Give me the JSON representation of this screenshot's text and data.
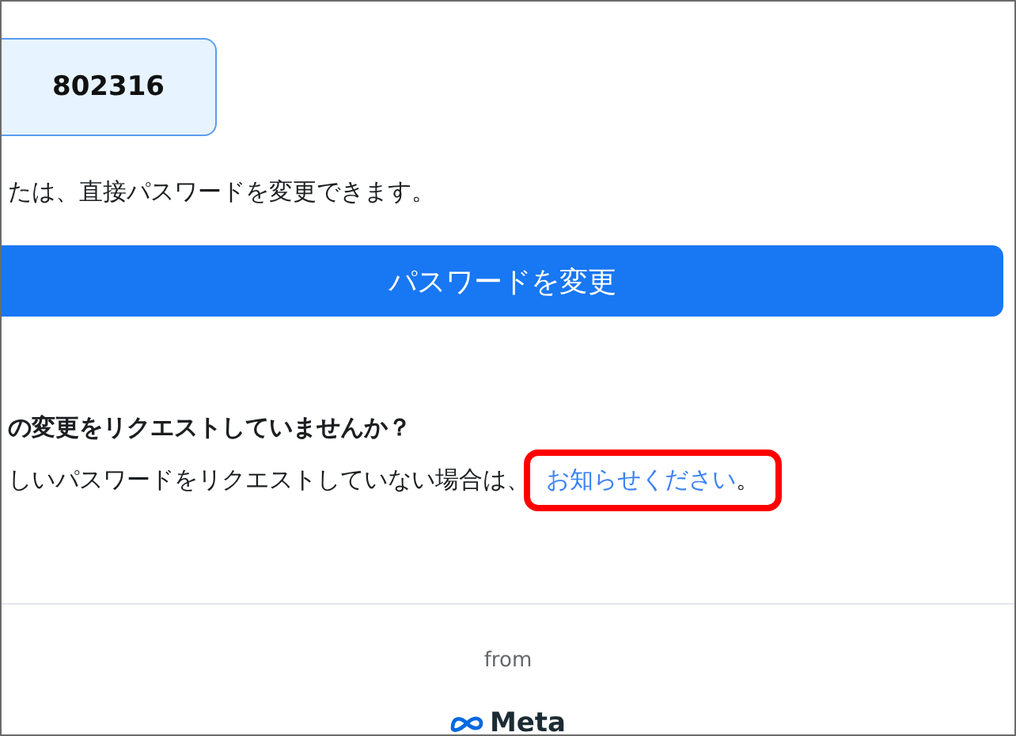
{
  "code": {
    "value": "802316"
  },
  "instruction": "たは、直接パスワードを変更できます。",
  "change_button": {
    "label": "パスワードを変更"
  },
  "notice": {
    "heading": "の変更をリクエストしていませんか？",
    "text": "しいパスワードをリクエストしていない場合は、",
    "link": {
      "label": "お知らせください",
      "highlighted": true
    },
    "end": "。"
  },
  "footer": {
    "from": "from",
    "brand": "Meta"
  }
}
